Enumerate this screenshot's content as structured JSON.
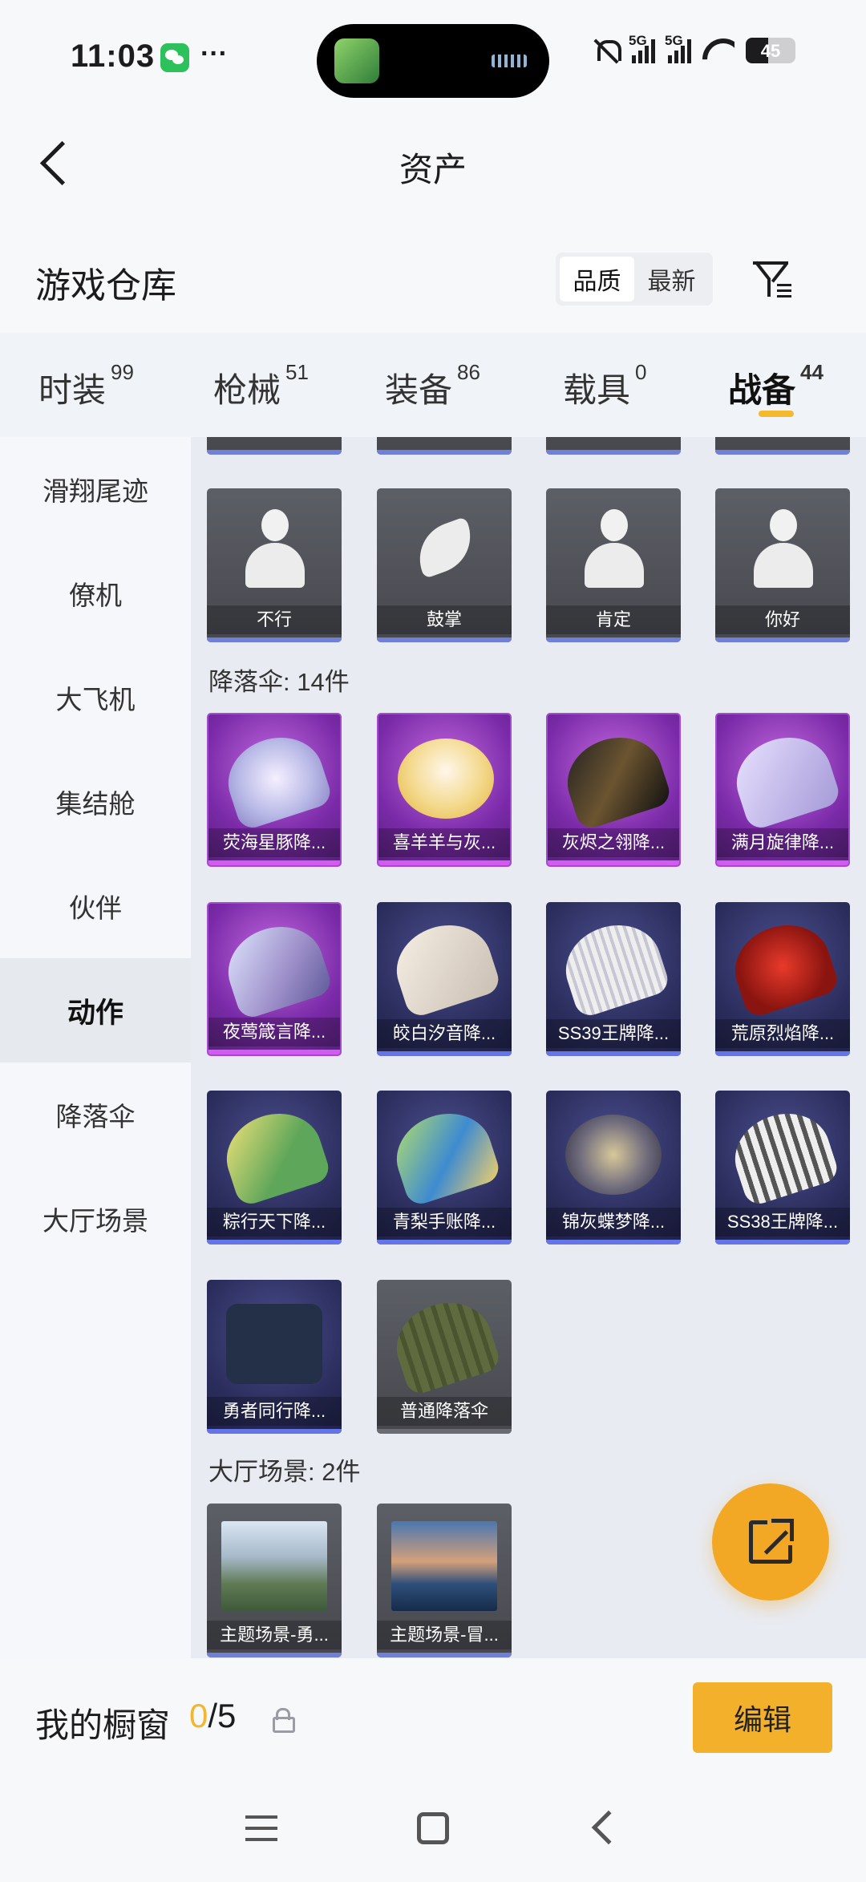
{
  "status_bar": {
    "time": "11:03",
    "dots": "···",
    "battery": "45",
    "net1": "5G",
    "net2": "5G"
  },
  "header": {
    "title": "资产"
  },
  "repo": {
    "title": "游戏仓库",
    "sort": [
      "品质",
      "最新"
    ]
  },
  "tabs": [
    {
      "label": "时装",
      "count": "99"
    },
    {
      "label": "枪械",
      "count": "51"
    },
    {
      "label": "装备",
      "count": "86"
    },
    {
      "label": "载具",
      "count": "0"
    },
    {
      "label": "战备",
      "count": "44"
    }
  ],
  "sidebar": [
    "滑翔尾迹",
    "僚机",
    "大飞机",
    "集结舱",
    "伙伴",
    "动作",
    "降落伞",
    "大厅场景"
  ],
  "emotes": [
    "不行",
    "鼓掌",
    "肯定",
    "你好"
  ],
  "parachute_section": "降落伞: 14件",
  "parachutes": [
    "荧海星豚降...",
    "喜羊羊与灰...",
    "灰烬之翎降...",
    "满月旋律降...",
    "夜莺箴言降...",
    "皎白汐音降...",
    "SS39王牌降...",
    "荒原烈焰降...",
    "粽行天下降...",
    "青梨手账降...",
    "锦灰蝶梦降...",
    "SS38王牌降...",
    "勇者同行降...",
    "普通降落伞"
  ],
  "lobby_section": "大厅场景: 2件",
  "lobby": [
    "主题场景-勇...",
    "主题场景-冒..."
  ],
  "showcase": {
    "title": "我的橱窗",
    "current": "0",
    "total": "/5",
    "edit": "编辑"
  },
  "colors": {
    "accent": "#f2b02b",
    "purple": "#a44ad0",
    "blue": "#2a2c5b"
  }
}
